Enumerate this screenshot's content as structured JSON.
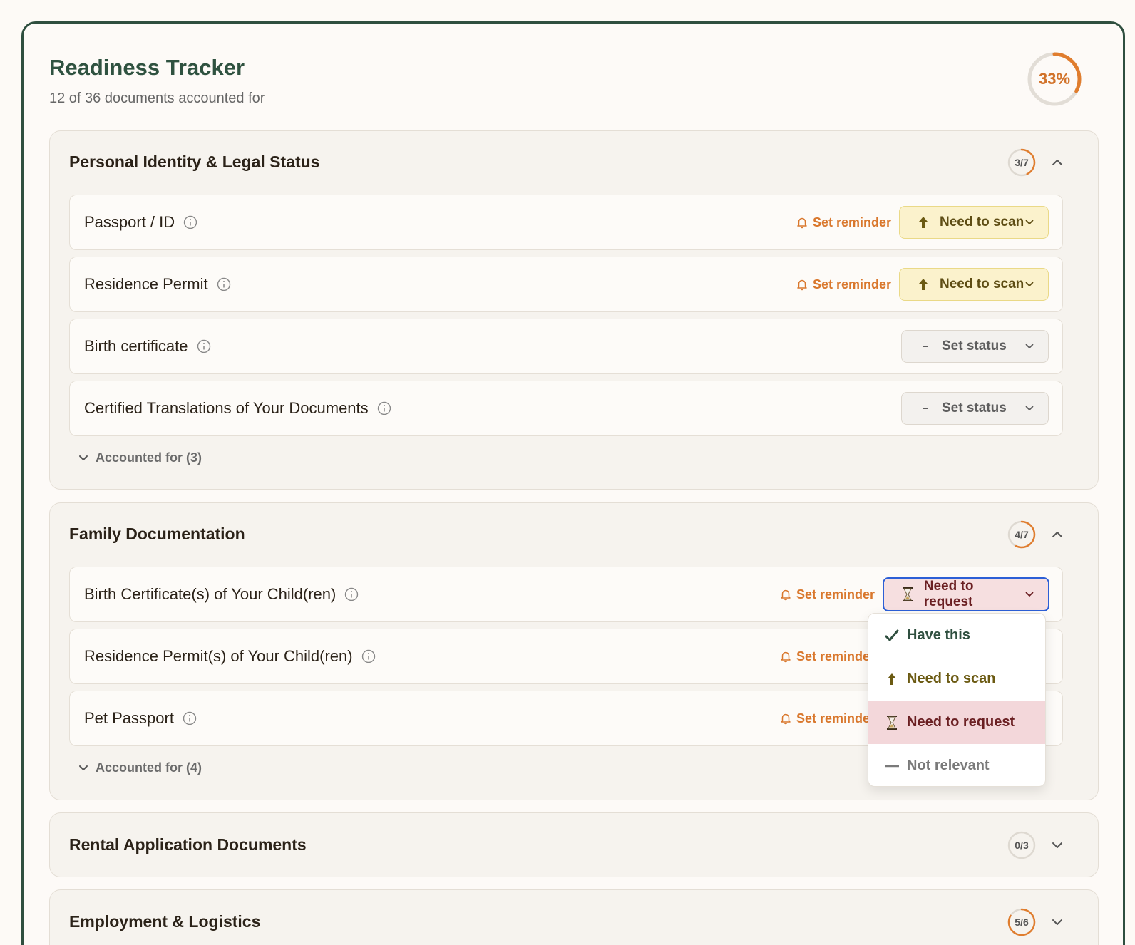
{
  "header": {
    "title": "Readiness Tracker",
    "subtitle": "12 of 36 documents accounted for",
    "overall_percent_label": "33%",
    "overall_progress": 0.33
  },
  "colors": {
    "accent_orange": "#d9772c",
    "brand_green": "#2f5240",
    "scan_bg": "#fbf2cc",
    "request_bg": "#f6dfe0",
    "focus_blue": "#2c5fd6"
  },
  "common": {
    "reminder_label": "Set reminder",
    "reminder_icon": "bell-icon",
    "info_icon": "info-icon"
  },
  "sections": [
    {
      "title": "Personal Identity & Legal Status",
      "progress_label": "3/7",
      "progress": 0.4286,
      "expanded": true,
      "items": [
        {
          "name": "Passport / ID",
          "status": "Need to scan",
          "has_reminder": true
        },
        {
          "name": "Residence Permit",
          "status": "Need to scan",
          "has_reminder": true
        },
        {
          "name": "Birth certificate",
          "status": "Set status",
          "has_reminder": false
        },
        {
          "name": "Certified Translations of Your Documents",
          "status": "Set status",
          "has_reminder": false
        }
      ],
      "accounted_label": "Accounted for (3)"
    },
    {
      "title": "Family Documentation",
      "progress_label": "4/7",
      "progress": 0.5714,
      "expanded": true,
      "items": [
        {
          "name": "Birth Certificate(s) of Your Child(ren)",
          "status": "Need to request",
          "has_reminder": true
        },
        {
          "name": "Residence Permit(s) of Your Child(ren)",
          "status": "",
          "has_reminder": true
        },
        {
          "name": "Pet Passport",
          "status": "",
          "has_reminder": true
        }
      ],
      "accounted_label": "Accounted for (4)"
    },
    {
      "title": "Rental Application Documents",
      "progress_label": "0/3",
      "progress": 0,
      "expanded": false
    },
    {
      "title": "Employment & Logistics",
      "progress_label": "5/6",
      "progress": 0.8333,
      "expanded": false
    }
  ],
  "status_menu": {
    "options": [
      {
        "label": "Have this",
        "icon": "checkmark-icon"
      },
      {
        "label": "Need to scan",
        "icon": "upload-arrow-icon"
      },
      {
        "label": "Need to request",
        "icon": "hourglass-icon",
        "selected": true
      },
      {
        "label": "Not relevant",
        "icon": "dash-icon"
      }
    ]
  }
}
